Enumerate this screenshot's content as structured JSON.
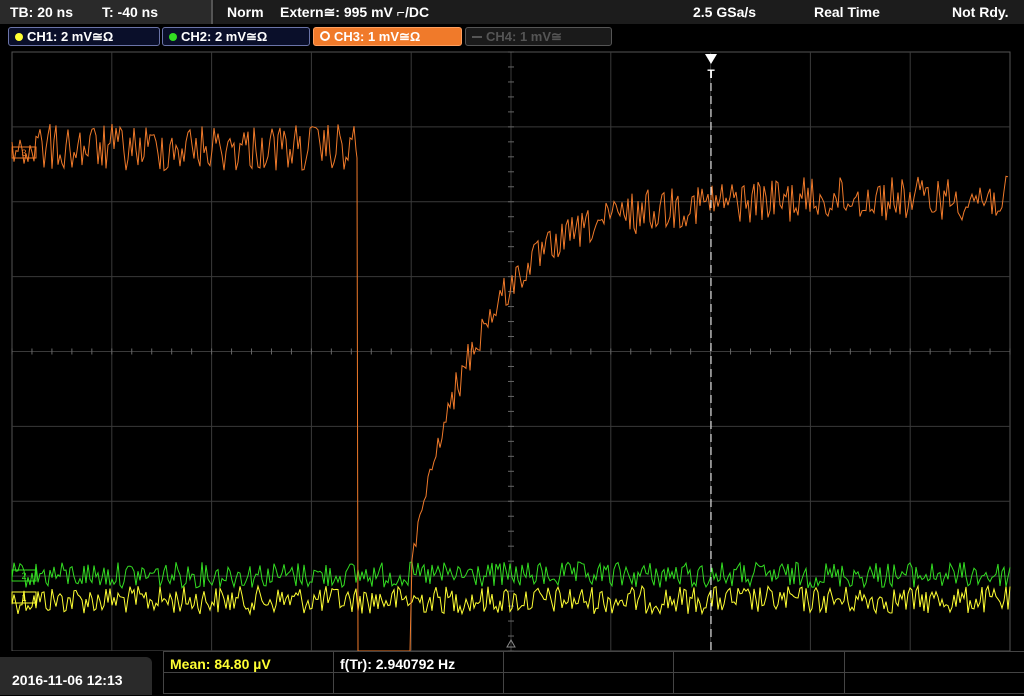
{
  "topbar": {
    "timebase": "TB: 20 ns",
    "trigger_time": "T: -40 ns",
    "trigger_mode": "Norm",
    "trigger_source": "Extern≅: 995 mV ⌐/DC",
    "sample_rate": "2.5 GSa/s",
    "acq_mode": "Real Time",
    "status": "Not Rdy."
  },
  "channels": [
    {
      "label": "CH1: 2 mV≅Ω",
      "color": "#ffff33"
    },
    {
      "label": "CH2: 2 mV≅Ω",
      "color": "#33dd22"
    },
    {
      "label": "CH3: 1 mV≅Ω",
      "color": "#f07a2a"
    },
    {
      "label": "CH4: 1 mV≅",
      "color": "#555555"
    }
  ],
  "markers": {
    "ch3_ref": "3",
    "ch2_ref": "2",
    "ch1_ref": "1",
    "trigger": "T"
  },
  "measurements": {
    "mean": "Mean: 84.80 µV",
    "freq": "f(Tr): 2.940792 Hz"
  },
  "datetime": "2016-11-06 12:13",
  "colors": {
    "ch1": "#ffff33",
    "ch2": "#33dd22",
    "ch3": "#f07a2a",
    "grid": "#444444",
    "trigger_line": "#ffffff"
  }
}
